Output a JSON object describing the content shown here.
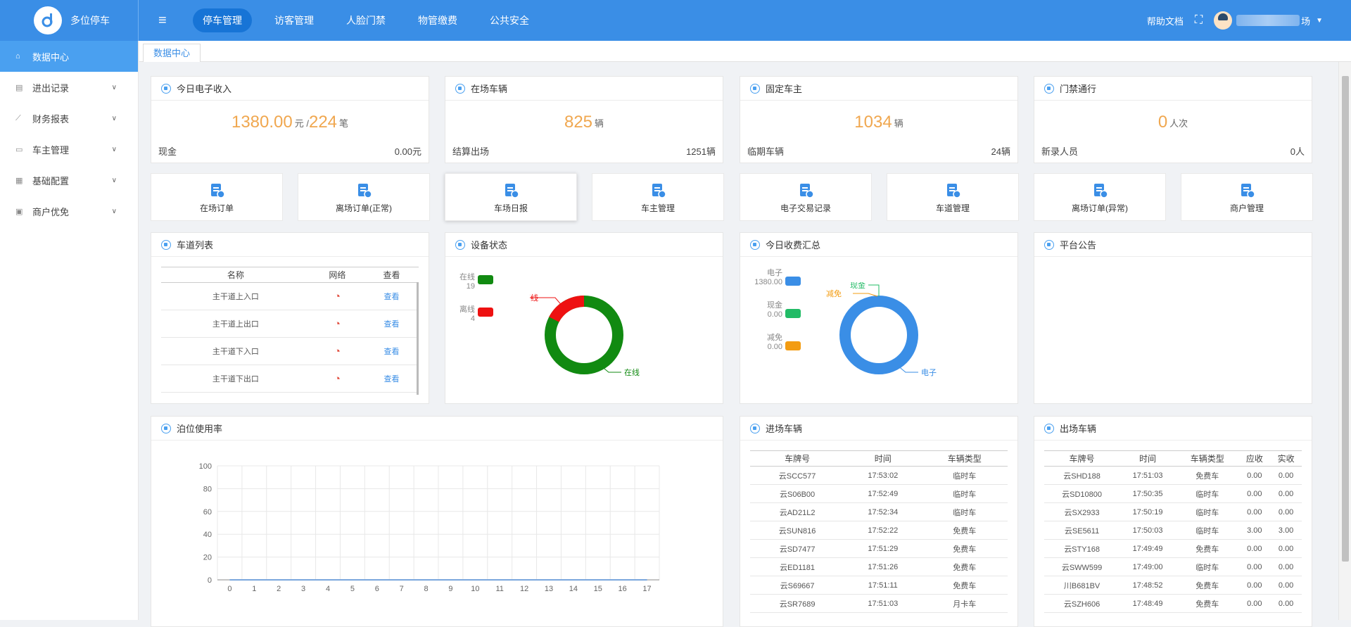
{
  "app": {
    "name": "多位停车"
  },
  "topnav": {
    "items": [
      {
        "label": "停车管理",
        "active": true
      },
      {
        "label": "访客管理"
      },
      {
        "label": "人脸门禁"
      },
      {
        "label": "物管缴费"
      },
      {
        "label": "公共安全"
      }
    ],
    "help": "帮助文档",
    "user_suffix": "场"
  },
  "sidebar": {
    "items": [
      {
        "label": "数据中心",
        "icon": "home-icon",
        "active": true
      },
      {
        "label": "进出记录",
        "icon": "doc-icon"
      },
      {
        "label": "财务报表",
        "icon": "chart-icon"
      },
      {
        "label": "车主管理",
        "icon": "car-icon"
      },
      {
        "label": "基础配置",
        "icon": "grid-icon"
      },
      {
        "label": "商户优免",
        "icon": "shop-icon"
      }
    ]
  },
  "tab": {
    "label": "数据中心"
  },
  "stats": {
    "income": {
      "title": "今日电子收入",
      "amount": "1380.00",
      "unit1": "元 / ",
      "count": "224",
      "unit2": "笔",
      "sub_label": "现金",
      "sub_value": "0.00元"
    },
    "parked": {
      "title": "在场车辆",
      "value": "825",
      "unit": "辆",
      "sub_label": "结算出场",
      "sub_value": "1251辆"
    },
    "fixed": {
      "title": "固定车主",
      "value": "1034",
      "unit": "辆",
      "sub_label": "临期车辆",
      "sub_value": "24辆"
    },
    "access": {
      "title": "门禁通行",
      "value": "0",
      "unit": "人次",
      "sub_label": "新录人员",
      "sub_value": "0人"
    }
  },
  "quick": [
    {
      "label": "在场订单",
      "icon": "order-in-icon"
    },
    {
      "label": "离场订单(正常)",
      "icon": "order-out-icon"
    },
    {
      "label": "车场日报",
      "icon": "daily-report-icon"
    },
    {
      "label": "车主管理",
      "icon": "owner-manage-icon"
    },
    {
      "label": "电子交易记录",
      "icon": "transaction-icon"
    },
    {
      "label": "车道管理",
      "icon": "lane-manage-icon"
    },
    {
      "label": "离场订单(异常)",
      "icon": "order-abnormal-icon"
    },
    {
      "label": "商户管理",
      "icon": "merchant-icon"
    }
  ],
  "lanes": {
    "title": "车道列表",
    "headers": [
      "名称",
      "网络",
      "查看"
    ],
    "rows": [
      {
        "name": "主干道上入口",
        "view": "查看"
      },
      {
        "name": "主干道上出口",
        "view": "查看"
      },
      {
        "name": "主干道下入口",
        "view": "查看"
      },
      {
        "name": "主干道下出口",
        "view": "查看"
      }
    ]
  },
  "device": {
    "title": "设备状态",
    "online_label": "在线",
    "online_value": "19",
    "offline_label": "离线",
    "offline_value": "4",
    "colors": {
      "online": "#118a11",
      "offline": "#ee1111"
    }
  },
  "fees": {
    "title": "今日收费汇总",
    "e_label": "电子",
    "e_value": "1380.00",
    "cash_label": "现金",
    "cash_value": "0.00",
    "cut_label": "减免",
    "cut_value": "0.00",
    "colors": {
      "e": "#3a8ee6",
      "cash": "#22bb66",
      "cut": "#f39c12"
    }
  },
  "notice": {
    "title": "平台公告"
  },
  "usage": {
    "title": "泊位使用率"
  },
  "chart_data": {
    "type": "line",
    "x": [
      0,
      1,
      2,
      3,
      4,
      5,
      6,
      7,
      8,
      9,
      10,
      11,
      12,
      13,
      14,
      15,
      16,
      17
    ],
    "series": [
      {
        "values": [
          0,
          0,
          0,
          0,
          0,
          0,
          0,
          0,
          0,
          0,
          0,
          0,
          0,
          0,
          0,
          0,
          0,
          0
        ]
      }
    ],
    "ylim": [
      0,
      100
    ],
    "yticks": [
      0,
      20,
      40,
      60,
      80,
      100
    ],
    "grid": true
  },
  "entry": {
    "title": "进场车辆",
    "headers": [
      "车牌号",
      "时间",
      "车辆类型"
    ],
    "rows": [
      [
        "云SCC577",
        "17:53:02",
        "临时车"
      ],
      [
        "云S06B00",
        "17:52:49",
        "临时车"
      ],
      [
        "云AD21L2",
        "17:52:34",
        "临时车"
      ],
      [
        "云SUN816",
        "17:52:22",
        "免费车"
      ],
      [
        "云SD7477",
        "17:51:29",
        "免费车"
      ],
      [
        "云ED1181",
        "17:51:26",
        "免费车"
      ],
      [
        "云S69667",
        "17:51:11",
        "免费车"
      ],
      [
        "云SR7689",
        "17:51:03",
        "月卡车"
      ]
    ]
  },
  "exit": {
    "title": "出场车辆",
    "headers": [
      "车牌号",
      "时间",
      "车辆类型",
      "应收",
      "实收"
    ],
    "rows": [
      [
        "云SHD188",
        "17:51:03",
        "免费车",
        "0.00",
        "0.00"
      ],
      [
        "云SD10800",
        "17:50:35",
        "临时车",
        "0.00",
        "0.00"
      ],
      [
        "云SX2933",
        "17:50:19",
        "临时车",
        "0.00",
        "0.00"
      ],
      [
        "云SE5611",
        "17:50:03",
        "临时车",
        "3.00",
        "3.00"
      ],
      [
        "云STY168",
        "17:49:49",
        "免费车",
        "0.00",
        "0.00"
      ],
      [
        "云SWW599",
        "17:49:00",
        "临时车",
        "0.00",
        "0.00"
      ],
      [
        "川B681BV",
        "17:48:52",
        "免费车",
        "0.00",
        "0.00"
      ],
      [
        "云SZH606",
        "17:48:49",
        "免费车",
        "0.00",
        "0.00"
      ]
    ]
  }
}
